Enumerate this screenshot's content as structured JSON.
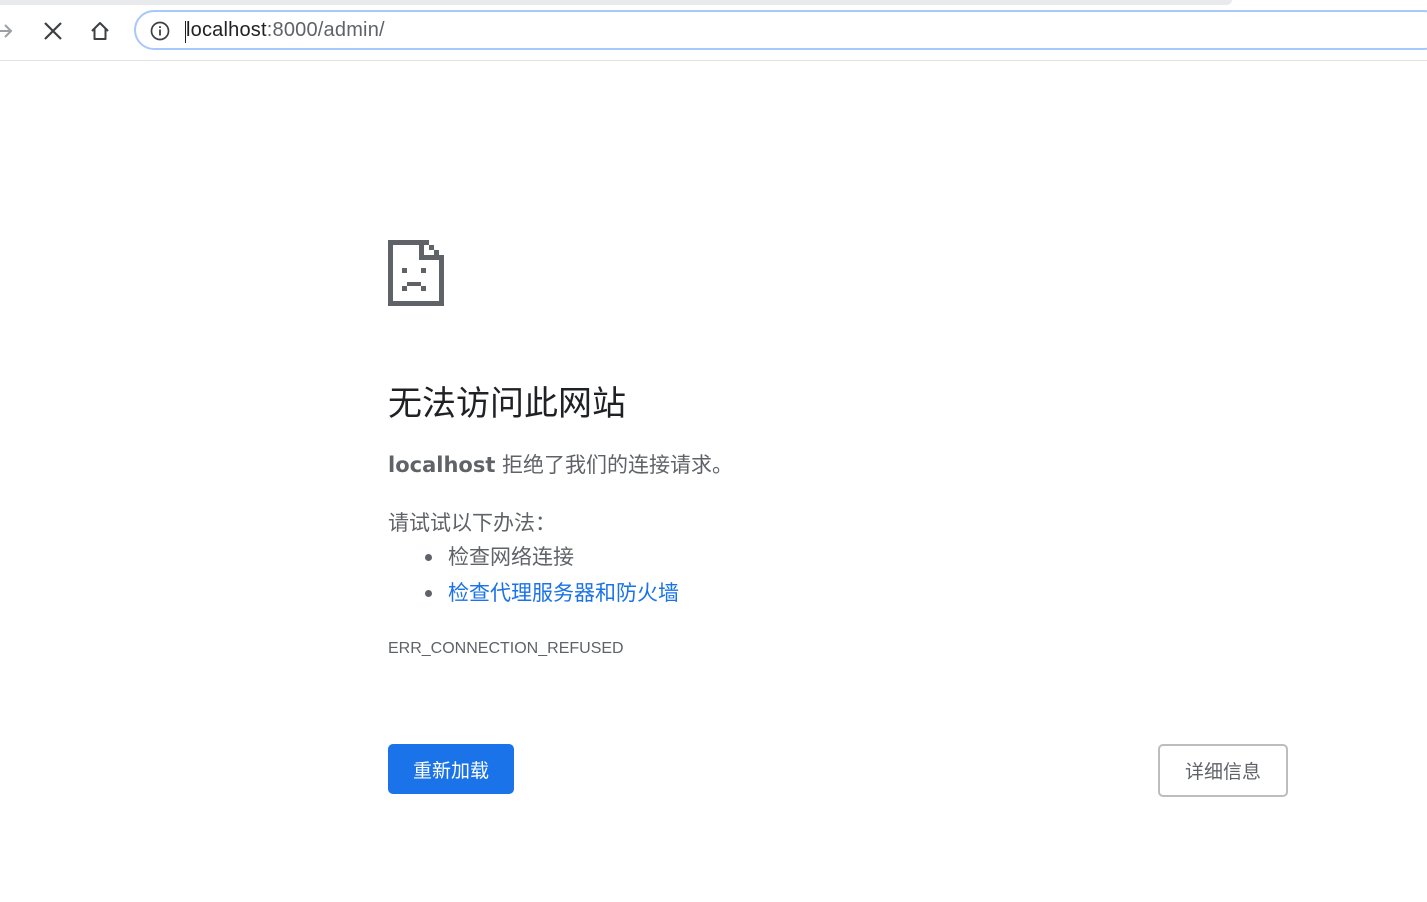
{
  "browser": {
    "url_host": "localhost",
    "url_rest": ":8000/admin/"
  },
  "error_page": {
    "heading": "无法访问此网站",
    "summary_host": "localhost",
    "summary_text": " 拒绝了我们的连接请求。",
    "suggest_intro": "请试试以下办法：",
    "suggestions": [
      "检查网络连接",
      "检查代理服务器和防火墙"
    ],
    "error_code": "ERR_CONNECTION_REFUSED",
    "reload_label": "重新加载",
    "details_label": "详细信息"
  },
  "colors": {
    "accent": "#1a73e8",
    "text_primary": "#202124",
    "text_secondary": "#5f6368"
  },
  "icons": {
    "forward": "arrow-forward-icon",
    "stop": "close-icon",
    "home": "home-icon",
    "site_info": "info-circle-icon",
    "sad_page": "sad-document-icon"
  }
}
